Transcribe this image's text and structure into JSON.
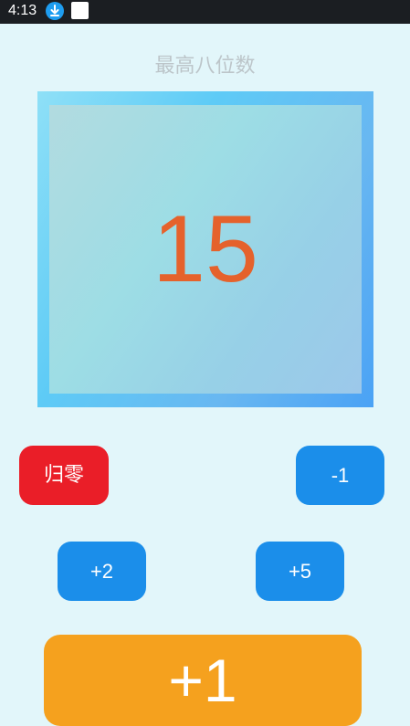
{
  "status_bar": {
    "time": "4:13",
    "icons": [
      "download-icon",
      "notification-square-icon"
    ]
  },
  "header": {
    "subtitle": "最高八位数"
  },
  "display": {
    "value": "15"
  },
  "buttons": {
    "reset": "归零",
    "minus1": "-1",
    "plus2": "+2",
    "plus5": "+5",
    "plus1": "+1"
  },
  "colors": {
    "background": "#e2f6fa",
    "counter_text": "#e5622c",
    "reset_button": "#ea1e28",
    "step_buttons": "#1b8eea",
    "plus1_button": "#f5a11e"
  }
}
